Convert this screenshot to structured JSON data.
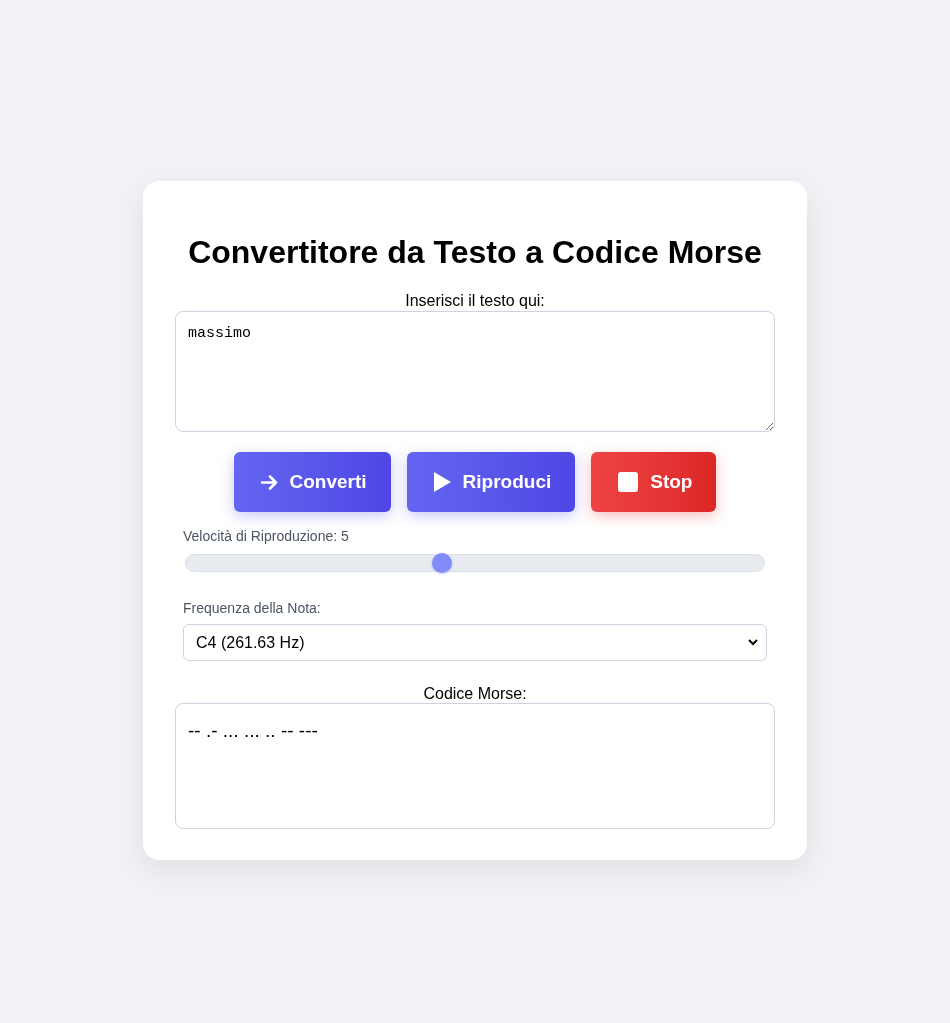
{
  "title": "Convertitore da Testo a Codice Morse",
  "input": {
    "label": "Inserisci il testo qui:",
    "value": "massimo"
  },
  "buttons": [
    {
      "kind": "convert",
      "label": "Converti"
    },
    {
      "kind": "play",
      "label": "Riproduci"
    },
    {
      "kind": "stop",
      "label": "Stop"
    }
  ],
  "speed": {
    "label": "Velocità di Riproduzione: 5",
    "level": 0.44
  },
  "frequency": {
    "label": "Frequenza della Nota:",
    "value": "C4 (261.63 Hz)"
  },
  "output": {
    "label": "Codice Morse:",
    "value": "-- .- ... ... .. -- ---"
  }
}
